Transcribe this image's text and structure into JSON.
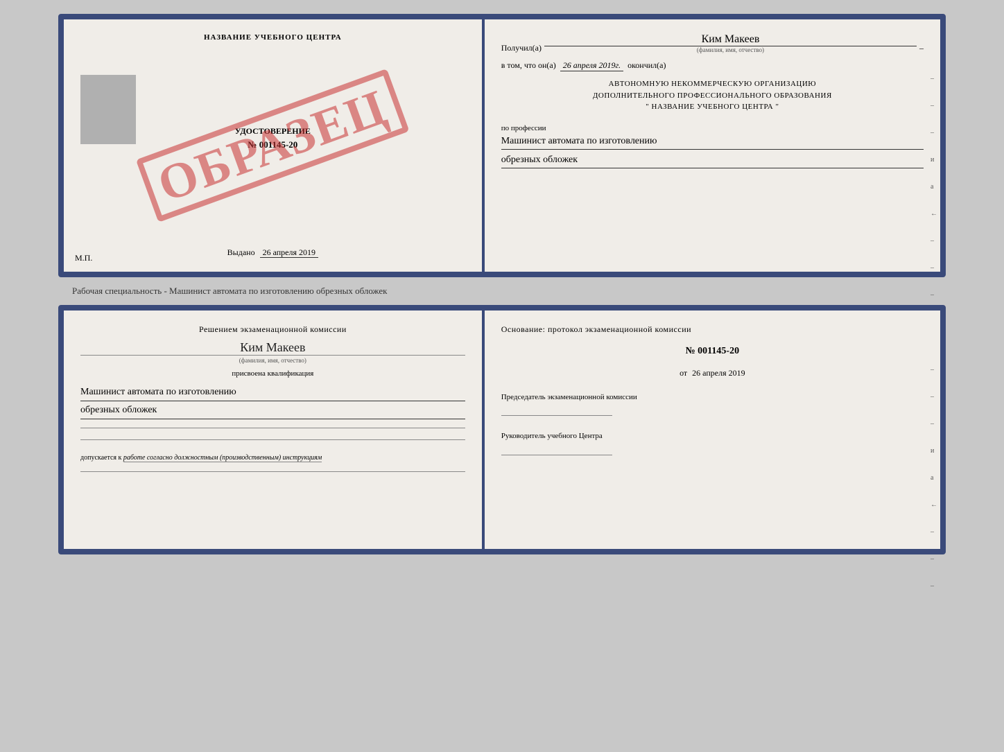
{
  "top_document": {
    "left_page": {
      "title": "НАЗВАНИЕ УЧЕБНОГО ЦЕНТРА",
      "cert_type": "УДОСТОВЕРЕНИЕ",
      "cert_number": "№ 001145-20",
      "stamp_text": "ОБРАЗЕЦ",
      "issued_label": "Выдано",
      "issued_date": "26 апреля 2019",
      "mp_label": "М.П."
    },
    "right_page": {
      "received_label": "Получил(а)",
      "received_name": "Ким Макеев",
      "fio_hint": "(фамилия, имя, отчество)",
      "date_prefix": "в том, что он(а)",
      "date_value": "26 апреля 2019г.",
      "finished_label": "окончил(а)",
      "org_line1": "АВТОНОМНУЮ НЕКОММЕРЧЕСКУЮ ОРГАНИЗАЦИЮ",
      "org_line2": "ДОПОЛНИТЕЛЬНОГО ПРОФЕССИОНАЛЬНОГО ОБРАЗОВАНИЯ",
      "org_line3": "\"  НАЗВАНИЕ УЧЕБНОГО ЦЕНТРА  \"",
      "profession_label": "по профессии",
      "profession_line1": "Машинист автомата по изготовлению",
      "profession_line2": "обрезных обложек",
      "side_marks": [
        "-",
        "-",
        "-",
        "и",
        "а",
        "←",
        "-",
        "-",
        "-",
        "-"
      ]
    }
  },
  "caption": {
    "text": "Рабочая специальность - Машинист автомата по изготовлению обрезных обложек"
  },
  "bottom_document": {
    "left_page": {
      "decision_text": "Решением экзаменационной комиссии",
      "person_name": "Ким Макеев",
      "fio_label": "(фамилия, имя, отчество)",
      "qualification_label": "присвоена квалификация",
      "qualification_line1": "Машинист автомата по изготовлению",
      "qualification_line2": "обрезных обложек",
      "allowed_prefix": "допускается к",
      "allowed_italic": "работе согласно должностным (производственным) инструкциям"
    },
    "right_page": {
      "basis_label": "Основание: протокол экзаменационной комиссии",
      "protocol_number": "№  001145-20",
      "date_prefix": "от",
      "date_value": "26 апреля 2019",
      "chairman_label": "Председатель экзаменационной комиссии",
      "head_label": "Руководитель учебного Центра",
      "side_marks": [
        "-",
        "-",
        "-",
        "и",
        "а",
        "←",
        "-",
        "-",
        "-",
        "-"
      ]
    }
  }
}
